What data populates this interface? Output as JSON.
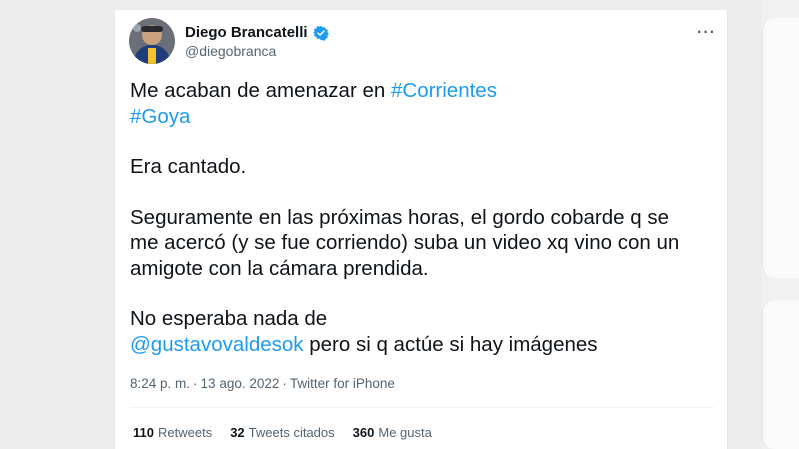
{
  "tweet": {
    "author_name": "Diego Brancatelli",
    "author_handle": "@diegobranca",
    "verified": true,
    "more_label": "···",
    "text": {
      "line1_prefix": "Me acaban de amenazar en ",
      "hashtag1": "#Corrientes",
      "hashtag2": "#Goya",
      "para2": "Era cantado.",
      "para3_line1": "Seguramente en las próximas horas, el gordo cobarde q se",
      "para3_line2": "me acercó (y se fue corriendo) suba un video xq vino con un",
      "para3_line3": "amigote con la cámara prendida.",
      "para4_line1": "No esperaba nada de",
      "mention": "@gustavovaldesok",
      "para4_suffix": " pero si q actúe si hay imágenes"
    },
    "time": "8:24 p. m.",
    "separator": "·",
    "date": "13 ago. 2022",
    "source": "Twitter for iPhone",
    "stats": {
      "retweets_count": "110",
      "retweets_label": "Retweets",
      "quotes_count": "32",
      "quotes_label": "Tweets citados",
      "likes_count": "360",
      "likes_label": "Me gusta"
    }
  },
  "colors": {
    "link": "#1d9bf0",
    "text": "#0f1419",
    "secondary": "#536471",
    "verified": "#1d9bf0"
  }
}
